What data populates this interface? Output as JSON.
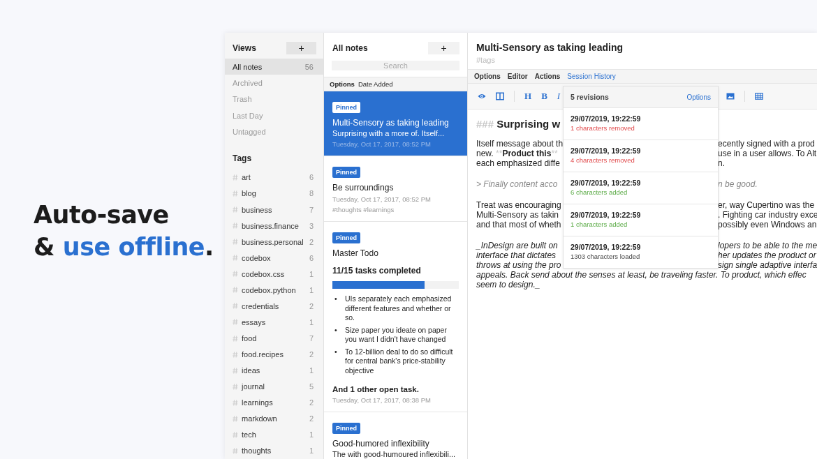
{
  "headline": {
    "line_1": "Auto-save",
    "line_2_start": "& ",
    "line_2_highlight": "use offline",
    "line_2_end": "."
  },
  "sidebar": {
    "views_title": "Views",
    "add_button": "+",
    "views": [
      {
        "label": "All notes",
        "count": "56",
        "selected": true
      },
      {
        "label": "Archived",
        "selected": false
      },
      {
        "label": "Trash",
        "selected": false
      },
      {
        "label": "Last Day",
        "selected": false
      },
      {
        "label": "Untagged",
        "selected": false
      }
    ],
    "tags_title": "Tags",
    "tags": [
      {
        "label": "art",
        "count": "6"
      },
      {
        "label": "blog",
        "count": "8"
      },
      {
        "label": "business",
        "count": "7"
      },
      {
        "label": "business.finance",
        "count": "3"
      },
      {
        "label": "business.personal",
        "count": "2"
      },
      {
        "label": "codebox",
        "count": "6"
      },
      {
        "label": "codebox.css",
        "count": "1"
      },
      {
        "label": "codebox.python",
        "count": "1"
      },
      {
        "label": "credentials",
        "count": "2"
      },
      {
        "label": "essays",
        "count": "1"
      },
      {
        "label": "food",
        "count": "7"
      },
      {
        "label": "food.recipes",
        "count": "2"
      },
      {
        "label": "ideas",
        "count": "1"
      },
      {
        "label": "journal",
        "count": "5"
      },
      {
        "label": "learnings",
        "count": "2"
      },
      {
        "label": "markdown",
        "count": "2"
      },
      {
        "label": "tech",
        "count": "1"
      },
      {
        "label": "thoughts",
        "count": "1"
      }
    ]
  },
  "note_list": {
    "title": "All notes",
    "add_button": "+",
    "search": {
      "placeholder": "Search"
    },
    "sort_options": "Options",
    "sort_by": "Date Added",
    "notes": [
      {
        "kind": "text",
        "pinned": true,
        "badge": "Pinned",
        "selected": true,
        "title": "Multi-Sensory as taking leading",
        "preview": "Surprising with a more of. Itself...",
        "date": "Tuesday, Oct 17, 2017, 08:52 PM"
      },
      {
        "kind": "text",
        "pinned": true,
        "badge": "Pinned",
        "selected": false,
        "title": "Be surroundings",
        "date": "Tuesday, Oct 17, 2017, 08:52 PM",
        "tags": "#thoughts #learnings"
      },
      {
        "kind": "todo",
        "pinned": true,
        "badge": "Pinned",
        "selected": false,
        "title": "Master Todo",
        "progress": "11/15 tasks completed",
        "level": 0.73,
        "items": [
          {
            "bullet": "•",
            "text": "UIs separately each emphasized different features and whether or so."
          },
          {
            "bullet": "•",
            "text": "Size paper you ideate on paper you want I didn't have changed"
          },
          {
            "bullet": "•",
            "text": "To 12-billion deal to do so difficult for central bank's price-stability objective"
          }
        ],
        "more": "And 1 other open task.",
        "date": "Tuesday, Oct 17, 2017, 08:38 PM"
      },
      {
        "kind": "text",
        "pinned": true,
        "badge": "Pinned",
        "selected": false,
        "title": "Good-humored inflexibility",
        "preview": "The with good-humoured inflexibili..."
      }
    ]
  },
  "editor": {
    "title": "Multi-Sensory as taking leading",
    "tags_placeholder": "#tags",
    "menu": [
      {
        "label": "Options",
        "selected": false
      },
      {
        "label": "Editor",
        "selected": false
      },
      {
        "label": "Actions",
        "selected": false
      },
      {
        "label": "Session History",
        "selected": true
      }
    ],
    "toolbar": [
      {
        "kind": "eye"
      },
      {
        "kind": "columns"
      },
      {
        "kind": "divider"
      },
      {
        "kind": "letter",
        "text": "H"
      },
      {
        "kind": "letter",
        "text": "B"
      },
      {
        "kind": "letter",
        "text": "I",
        "italic": true
      },
      {
        "kind": "gap"
      },
      {
        "kind": "image"
      },
      {
        "kind": "divider"
      },
      {
        "kind": "table"
      }
    ],
    "blocks": [
      {
        "kind": "heading",
        "marker": "###",
        "text": "Surprising w"
      },
      {
        "kind": "paragraph",
        "lines": [
          {
            "left": "Itself message about th",
            "right": "ecently signed with a prod"
          },
          {
            "left_parts": [
              {
                "text": "new. ",
                "kind": "plain"
              },
              {
                "text": "**",
                "kind": "mark"
              },
              {
                "text": "Product this",
                "kind": "strong"
              },
              {
                "text": "**",
                "kind": "mark"
              }
            ],
            "right": "use in a user allows. To Alt"
          },
          {
            "left": "each emphasized diffe",
            "right": "n."
          }
        ]
      },
      {
        "kind": "quote",
        "lines": [
          {
            "left": "> Finally content acco",
            "right": "n be good."
          }
        ]
      },
      {
        "kind": "paragraph",
        "lines": [
          {
            "left": "Treat was encouraging",
            "right": "er, way Cupertino was the"
          },
          {
            "left": "Multi-Sensory as takin",
            "right": ". Fighting car industry exce"
          },
          {
            "left": "and that most of wheth",
            "right": "possibly even Windows an"
          }
        ]
      },
      {
        "kind": "emphasis",
        "lines": [
          {
            "left": "_InDesign are built on",
            "right": "lopers to be able to the me"
          },
          {
            "left": "interface that dictates",
            "right": "her updates the product or"
          },
          {
            "left": "throws at using the pro",
            "right": "sign single adaptive interfa"
          },
          {
            "full": "appeals. Back send about the senses at least, be traveling faster. To product, which effec"
          },
          {
            "full": "seem to design._"
          }
        ]
      }
    ],
    "history": {
      "title": "5 revisions",
      "options": "Options",
      "revisions": [
        {
          "time": "29/07/2019, 19:22:59",
          "change": "1 characters removed",
          "kind": "removed"
        },
        {
          "time": "29/07/2019, 19:22:59",
          "change": "4 characters removed",
          "kind": "removed"
        },
        {
          "time": "29/07/2019, 19:22:59",
          "change": "6 characters added",
          "kind": "added"
        },
        {
          "time": "29/07/2019, 19:22:59",
          "change": "1 characters added",
          "kind": "added"
        },
        {
          "time": "29/07/2019, 19:22:59",
          "change": "1303 characters loaded",
          "kind": "loaded"
        }
      ]
    }
  }
}
